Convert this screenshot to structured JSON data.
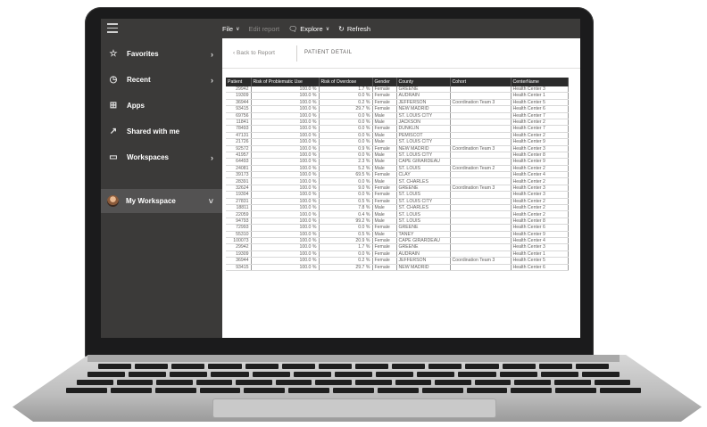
{
  "topbar": {
    "commands": [
      {
        "label": "File",
        "glyph": "",
        "caret": "∨",
        "disabled": false
      },
      {
        "label": "Edit report",
        "glyph": "",
        "caret": "",
        "disabled": true
      },
      {
        "label": "Explore",
        "glyph": "🗨",
        "caret": "∨",
        "disabled": false
      },
      {
        "label": "Refresh",
        "glyph": "↻",
        "caret": "",
        "disabled": false
      }
    ]
  },
  "nav": {
    "items": [
      {
        "label": "Favorites",
        "icon": "star-icon",
        "glyph": "☆",
        "chevron": "›"
      },
      {
        "label": "Recent",
        "icon": "clock-icon",
        "glyph": "◷",
        "chevron": "›"
      },
      {
        "label": "Apps",
        "icon": "apps-icon",
        "glyph": "⊞",
        "chevron": ""
      },
      {
        "label": "Shared with me",
        "icon": "shared-icon",
        "glyph": "↗",
        "chevron": ""
      },
      {
        "label": "Workspaces",
        "icon": "workspaces-icon",
        "glyph": "▭",
        "chevron": "›"
      },
      {
        "label": "My Workspace",
        "icon": "avatar",
        "glyph": "",
        "chevron": "˅"
      }
    ]
  },
  "report": {
    "back_label": "Back to Report",
    "back_glyph": "‹",
    "title": "PATIENT DETAIL"
  },
  "table": {
    "columns": [
      "Patient",
      "Risk of Problematic Use",
      "Risk of Overdose",
      "Gender",
      "County",
      "Cohort",
      "CenterName"
    ],
    "sort_glyph": "▼",
    "rows": [
      [
        "29942",
        "100.0 %",
        "1.7 %",
        "Female",
        "GREENE",
        "",
        "Health Center 3"
      ],
      [
        "19309",
        "100.0 %",
        "0.0 %",
        "Female",
        "AUDRAIN",
        "",
        "Health Center 1"
      ],
      [
        "36944",
        "100.0 %",
        "0.2 %",
        "Female",
        "JEFFERSON",
        "Coordination Team 3",
        "Health Center 5"
      ],
      [
        "93415",
        "100.0 %",
        "29.7 %",
        "Female",
        "NEW MADRID",
        "",
        "Health Center 6"
      ],
      [
        "69756",
        "100.0 %",
        "0.0 %",
        "Male",
        "ST. LOUIS CITY",
        "",
        "Health Center 7"
      ],
      [
        "11841",
        "100.0 %",
        "0.0 %",
        "Male",
        "JACKSON",
        "",
        "Health Center 2"
      ],
      [
        "78493",
        "100.0 %",
        "0.0 %",
        "Female",
        "DUNKLIN",
        "",
        "Health Center 7"
      ],
      [
        "47131",
        "100.0 %",
        "0.0 %",
        "Male",
        "PEMISCOT",
        "",
        "Health Center 2"
      ],
      [
        "21726",
        "100.0 %",
        "0.0 %",
        "Male",
        "ST. LOUIS CITY",
        "",
        "Health Center 9"
      ],
      [
        "92572",
        "100.0 %",
        "0.9 %",
        "Female",
        "NEW MADRID",
        "Coordination Team 3",
        "Health Center 3"
      ],
      [
        "41957",
        "100.0 %",
        "0.0 %",
        "Male",
        "ST. LOUIS CITY",
        "",
        "Health Center 8"
      ],
      [
        "64493",
        "100.0 %",
        "2.3 %",
        "Male",
        "CAPE GIRARDEAU",
        "",
        "Health Center 9"
      ],
      [
        "24081",
        "100.0 %",
        "5.2 %",
        "Male",
        "ST. LOUIS",
        "Coordination Team 2",
        "Health Center 2"
      ],
      [
        "39173",
        "100.0 %",
        "69.5 %",
        "Female",
        "CLAY",
        "",
        "Health Center 4"
      ],
      [
        "28391",
        "100.0 %",
        "0.0 %",
        "Male",
        "ST. CHARLES",
        "",
        "Health Center 2"
      ],
      [
        "32624",
        "100.0 %",
        "9.0 %",
        "Female",
        "GREENE",
        "Coordination Team 3",
        "Health Center 3"
      ],
      [
        "19304",
        "100.0 %",
        "0.0 %",
        "Female",
        "ST. LOUIS",
        "",
        "Health Center 3"
      ],
      [
        "27831",
        "100.0 %",
        "0.5 %",
        "Female",
        "ST. LOUIS CITY",
        "",
        "Health Center 2"
      ],
      [
        "18811",
        "100.0 %",
        "7.8 %",
        "Male",
        "ST. CHARLES",
        "",
        "Health Center 2"
      ],
      [
        "22059",
        "100.0 %",
        "0.4 %",
        "Male",
        "ST. LOUIS",
        "",
        "Health Center 2"
      ],
      [
        "94793",
        "100.0 %",
        "99.2 %",
        "Male",
        "ST. LOUIS",
        "",
        "Health Center 8"
      ],
      [
        "72993",
        "100.0 %",
        "0.0 %",
        "Female",
        "GREENE",
        "",
        "Health Center 6"
      ],
      [
        "55310",
        "100.0 %",
        "0.5 %",
        "Male",
        "TANEY",
        "",
        "Health Center 9"
      ],
      [
        "100073",
        "100.0 %",
        "20.9 %",
        "Female",
        "CAPE GIRARDEAU",
        "",
        "Health Center 4"
      ],
      [
        "29942",
        "100.0 %",
        "1.7 %",
        "Female",
        "GREENE",
        "",
        "Health Center 3"
      ],
      [
        "19309",
        "100.0 %",
        "0.0 %",
        "Female",
        "AUDRAIN",
        "",
        "Health Center 1"
      ],
      [
        "36944",
        "100.0 %",
        "0.2 %",
        "Female",
        "JEFFERSON",
        "Coordination Team 3",
        "Health Center 5"
      ],
      [
        "93415",
        "100.0 %",
        "29.7 %",
        "Female",
        "NEW MADRID",
        "",
        "Health Center 6"
      ]
    ]
  }
}
